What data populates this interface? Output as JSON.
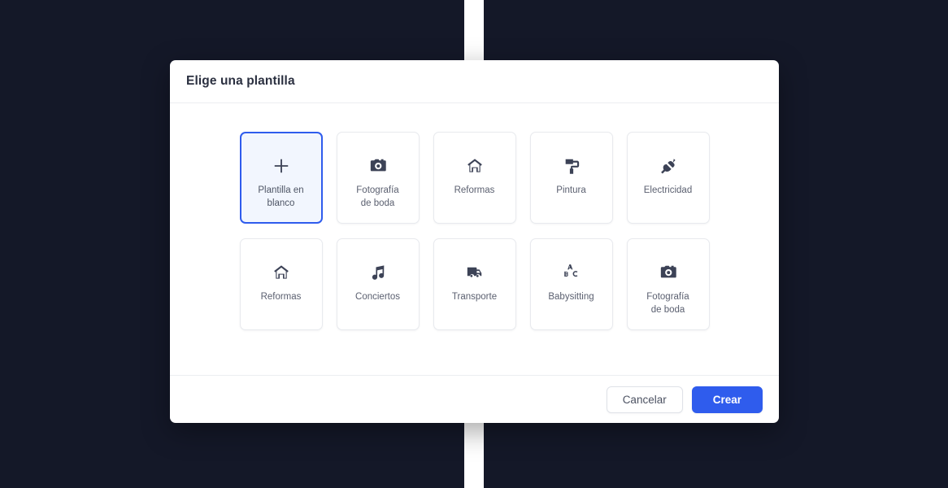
{
  "background": {
    "color": "#141828",
    "strip_color": "#ffffff"
  },
  "modal": {
    "title": "Elige una plantilla",
    "accent_color": "#2f5ced",
    "selected_card_bg": "#f2f6fe",
    "templates": [
      {
        "label": "Plantilla en\nblanco",
        "icon": "plus-icon",
        "selected": true
      },
      {
        "label": "Fotografía\nde boda",
        "icon": "camera-icon",
        "selected": false
      },
      {
        "label": "Reformas",
        "icon": "home-icon",
        "selected": false
      },
      {
        "label": "Pintura",
        "icon": "paint-roller-icon",
        "selected": false
      },
      {
        "label": "Electricidad",
        "icon": "plug-icon",
        "selected": false
      },
      {
        "label": "Reformas",
        "icon": "home-icon",
        "selected": false
      },
      {
        "label": "Conciertos",
        "icon": "music-note-icon",
        "selected": false
      },
      {
        "label": "Transporte",
        "icon": "truck-icon",
        "selected": false
      },
      {
        "label": "Babysitting",
        "icon": "abc-blocks-icon",
        "selected": false
      },
      {
        "label": "Fotografía\nde boda",
        "icon": "camera-icon",
        "selected": false
      }
    ],
    "footer": {
      "cancel_label": "Cancelar",
      "create_label": "Crear"
    }
  }
}
